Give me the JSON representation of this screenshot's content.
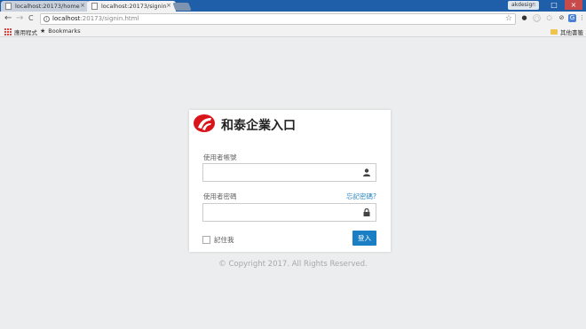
{
  "browser": {
    "tabs": [
      {
        "title": "localhost:20173/home",
        "close": "×"
      },
      {
        "title": "localhost:20173/signin",
        "close": "×"
      }
    ],
    "user_badge": "akdesign",
    "window_controls": {
      "minimize": "–",
      "maximize": "□",
      "close": "×"
    },
    "nav": {
      "back": "←",
      "forward": "→",
      "reload": "C"
    },
    "url_host": "localhost",
    "url_path": ":20173/signin.html",
    "star": "☆",
    "extensions": [
      "●",
      "○",
      "◌",
      "⊘",
      "G",
      "⋮"
    ],
    "bookmarks": {
      "apps_label": "應用程式",
      "bookmarks_label": "Bookmarks",
      "other_label": "其他書籤"
    }
  },
  "login": {
    "title": "和泰企業入口",
    "username_label": "使用者帳號",
    "password_label": "使用者密碼",
    "forgot_label": "忘記密碼?",
    "remember_label": "記住我",
    "submit_label": "登入",
    "username_value": "",
    "password_value": ""
  },
  "footer": {
    "copyright": "© Copyright 2017. All Rights Reserved."
  },
  "colors": {
    "brand_red": "#d9141b",
    "primary_button": "#1a7ec5",
    "link": "#2e86c1",
    "page_bg": "#ecedee"
  }
}
